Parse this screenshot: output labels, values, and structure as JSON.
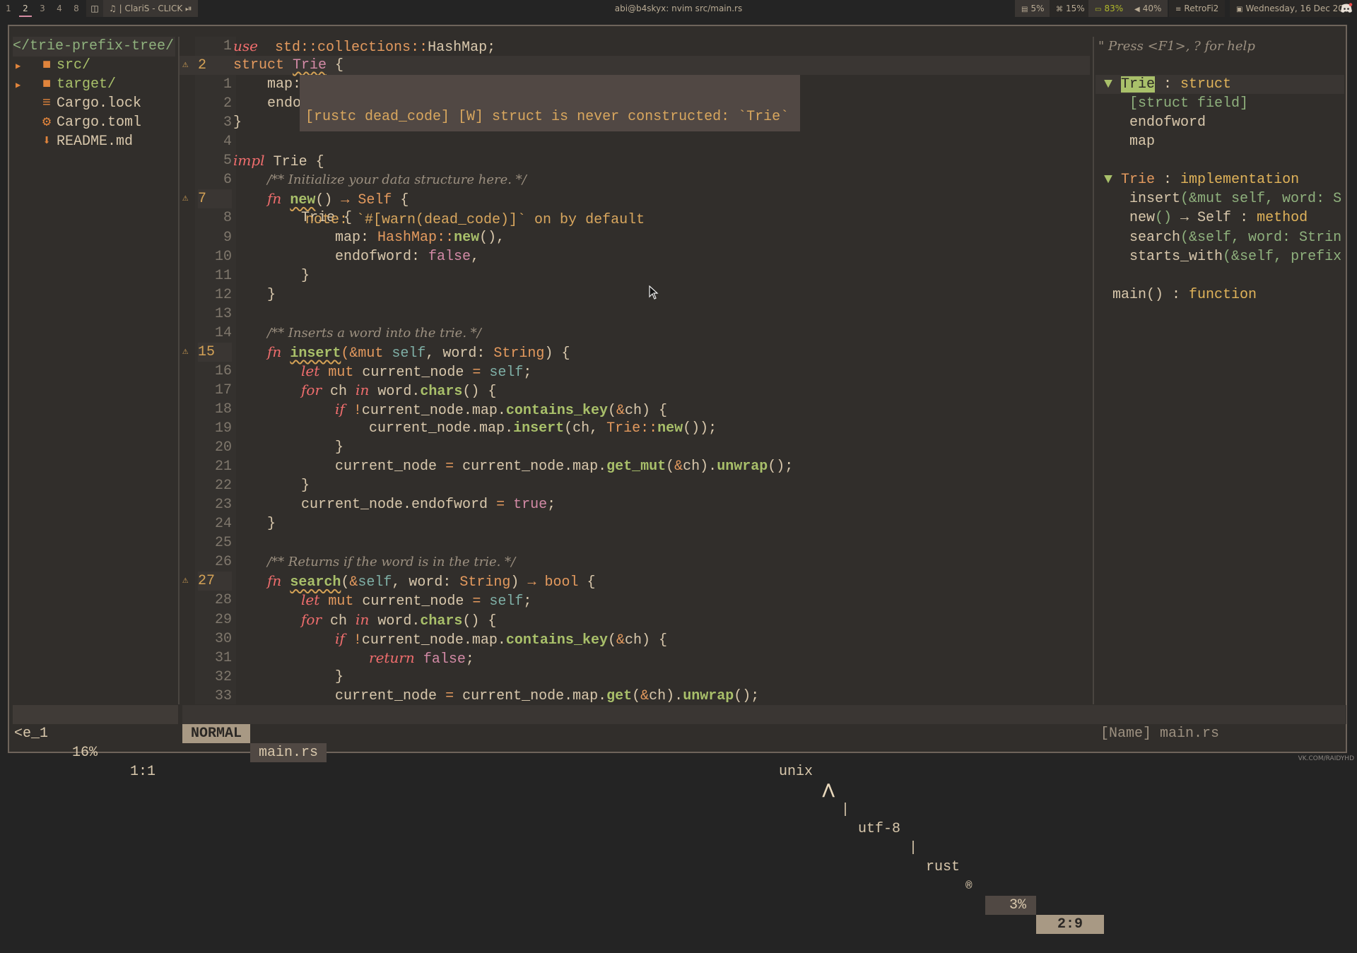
{
  "topbar": {
    "workspaces": [
      "1",
      "2",
      "3",
      "4",
      "8"
    ],
    "active_workspace": "2",
    "layout_icon": "layout-icon",
    "music": {
      "icon": "music-note-icon",
      "text": "| ClariS - CLICK",
      "control_icon": "play-pause-icon"
    },
    "window_title": "abi@b4skyx: nvim src/main.rs",
    "modules": [
      {
        "name": "memory",
        "icon": "memory-icon",
        "glyph": "▤",
        "value": "5%",
        "color": "#b9ab94"
      },
      {
        "name": "cpu",
        "icon": "cpu-icon",
        "glyph": "⌘",
        "value": "15%",
        "color": "#b9ab94"
      },
      {
        "name": "battery",
        "icon": "battery-icon",
        "glyph": "▭",
        "value": "83%",
        "color": "#b0b82a"
      },
      {
        "name": "volume",
        "icon": "volume-icon",
        "glyph": "◀",
        "value": "40%",
        "color": "#b9ab94"
      },
      {
        "name": "network",
        "icon": "wifi-icon",
        "glyph": "≡",
        "value": "RetroFi2",
        "color": "#b9ab94"
      },
      {
        "name": "date",
        "icon": "calendar-icon",
        "glyph": "▣",
        "value": "Wednesday, 16 Dec 20",
        "color": "#b9ab94"
      }
    ],
    "tray_icon": "discord-icon"
  },
  "filetree": {
    "root": "</trie-prefix-tree/",
    "items": [
      {
        "arrow": "▶",
        "icon": "folder-icon",
        "glyph": "■",
        "label": "src/",
        "type": "dir"
      },
      {
        "arrow": "▶",
        "icon": "folder-icon",
        "glyph": "■",
        "label": "target/",
        "type": "dir"
      },
      {
        "arrow": "",
        "icon": "lines-icon",
        "glyph": "≡",
        "label": "Cargo.lock",
        "type": "file"
      },
      {
        "arrow": "",
        "icon": "gear-icon",
        "glyph": "⚙",
        "label": "Cargo.toml",
        "type": "file"
      },
      {
        "arrow": "",
        "icon": "download-arrow-icon",
        "glyph": "⬇",
        "label": "README.md",
        "type": "file"
      }
    ]
  },
  "editor": {
    "diagnostic_popup": {
      "line1": "[rustc dead_code] [W] struct is never constructed: `Trie`",
      "line2": "",
      "line3": "note: `#[warn(dead_code)]` on by default"
    },
    "lines": [
      {
        "n": "1",
        "sign": "",
        "tokens": [
          [
            "kw",
            "use"
          ],
          [
            "",
            "  "
          ],
          [
            "ty",
            "std"
          ],
          [
            "op",
            "::"
          ],
          [
            "ty",
            "collections"
          ],
          [
            "op",
            "::"
          ],
          [
            "",
            "HashMap;"
          ]
        ]
      },
      {
        "n": "2",
        "sign": "⚠",
        "cur": true,
        "tokens": [
          [
            "ty",
            "struct "
          ],
          [
            "pk squig",
            "Trie"
          ],
          [
            "",
            " {"
          ]
        ]
      },
      {
        "n": "1",
        "sign": "",
        "tokens": [
          [
            "",
            "    map: HashMap<char, Trie>,"
          ]
        ]
      },
      {
        "n": "2",
        "sign": "",
        "tokens": [
          [
            "",
            "    endofword: bool,"
          ]
        ]
      },
      {
        "n": "3",
        "sign": "",
        "tokens": [
          [
            "",
            "}"
          ]
        ]
      },
      {
        "n": "4",
        "sign": "",
        "tokens": []
      },
      {
        "n": "5",
        "sign": "",
        "tokens": [
          [
            "kw",
            "impl"
          ],
          [
            "",
            " Trie {"
          ]
        ]
      },
      {
        "n": "6",
        "sign": "",
        "tokens": [
          [
            "",
            "    "
          ],
          [
            "cm",
            "/** Initialize your data structure here. */"
          ]
        ]
      },
      {
        "n": "7",
        "sign": "⚠",
        "tokens": [
          [
            "",
            "    "
          ],
          [
            "kw",
            "fn"
          ],
          [
            "",
            " "
          ],
          [
            "fnn squig",
            "new"
          ],
          [
            "",
            "() "
          ],
          [
            "op",
            "→"
          ],
          [
            "",
            " "
          ],
          [
            "ty",
            "Self"
          ],
          [
            "",
            " {"
          ]
        ]
      },
      {
        "n": "8",
        "sign": "",
        "tokens": [
          [
            "",
            "        Trie {"
          ]
        ]
      },
      {
        "n": "9",
        "sign": "",
        "tokens": [
          [
            "",
            "            map: "
          ],
          [
            "ty",
            "HashMap"
          ],
          [
            "op",
            "::"
          ],
          [
            "fnn",
            "new"
          ],
          [
            "",
            "(),"
          ]
        ]
      },
      {
        "n": "10",
        "sign": "",
        "tokens": [
          [
            "",
            "            endofword: "
          ],
          [
            "bool",
            "false"
          ],
          [
            "",
            ","
          ]
        ]
      },
      {
        "n": "11",
        "sign": "",
        "tokens": [
          [
            "",
            "        }"
          ]
        ]
      },
      {
        "n": "12",
        "sign": "",
        "tokens": [
          [
            "",
            "    }"
          ]
        ]
      },
      {
        "n": "13",
        "sign": "",
        "tokens": []
      },
      {
        "n": "14",
        "sign": "",
        "tokens": [
          [
            "",
            "    "
          ],
          [
            "cm",
            "/** Inserts a word into the trie. */"
          ]
        ]
      },
      {
        "n": "15",
        "sign": "⚠",
        "tokens": [
          [
            "",
            "    "
          ],
          [
            "kw",
            "fn"
          ],
          [
            "",
            " "
          ],
          [
            "fnn squig",
            "insert"
          ],
          [
            "op",
            "(&"
          ],
          [
            "ty",
            "mut"
          ],
          [
            "",
            " "
          ],
          [
            "sf",
            "self"
          ],
          [
            "",
            ", word: "
          ],
          [
            "ty",
            "String"
          ],
          [
            "",
            ") {"
          ]
        ]
      },
      {
        "n": "16",
        "sign": "",
        "tokens": [
          [
            "",
            "        "
          ],
          [
            "kw",
            "let"
          ],
          [
            "",
            " "
          ],
          [
            "ty",
            "mut"
          ],
          [
            "",
            " current_node "
          ],
          [
            "op",
            "="
          ],
          [
            "",
            " "
          ],
          [
            "sf",
            "self"
          ],
          [
            "",
            ";"
          ]
        ]
      },
      {
        "n": "17",
        "sign": "",
        "tokens": [
          [
            "",
            "        "
          ],
          [
            "kw",
            "for"
          ],
          [
            "",
            " ch "
          ],
          [
            "kw",
            "in"
          ],
          [
            "",
            " word."
          ],
          [
            "fnn",
            "chars"
          ],
          [
            "",
            "() {"
          ]
        ]
      },
      {
        "n": "18",
        "sign": "",
        "tokens": [
          [
            "",
            "            "
          ],
          [
            "kw",
            "if"
          ],
          [
            "",
            " "
          ],
          [
            "op",
            "!"
          ],
          [
            "",
            "current_node.map."
          ],
          [
            "fnn",
            "contains_key"
          ],
          [
            "",
            "("
          ],
          [
            "op",
            "&"
          ],
          [
            "",
            "ch) {"
          ]
        ]
      },
      {
        "n": "19",
        "sign": "",
        "tokens": [
          [
            "",
            "                current_node.map."
          ],
          [
            "fnn",
            "insert"
          ],
          [
            "",
            "(ch, "
          ],
          [
            "ty",
            "Trie"
          ],
          [
            "op",
            "::"
          ],
          [
            "fnn",
            "new"
          ],
          [
            "",
            "());"
          ]
        ]
      },
      {
        "n": "20",
        "sign": "",
        "tokens": [
          [
            "",
            "            }"
          ]
        ]
      },
      {
        "n": "21",
        "sign": "",
        "tokens": [
          [
            "",
            "            current_node "
          ],
          [
            "op",
            "="
          ],
          [
            "",
            " current_node.map."
          ],
          [
            "fnn",
            "get_mut"
          ],
          [
            "",
            "("
          ],
          [
            "op",
            "&"
          ],
          [
            "",
            "ch)."
          ],
          [
            "fnn",
            "unwrap"
          ],
          [
            "",
            "();"
          ]
        ]
      },
      {
        "n": "22",
        "sign": "",
        "tokens": [
          [
            "",
            "        }"
          ]
        ]
      },
      {
        "n": "23",
        "sign": "",
        "tokens": [
          [
            "",
            "        current_node.endofword "
          ],
          [
            "op",
            "="
          ],
          [
            "",
            " "
          ],
          [
            "bool",
            "true"
          ],
          [
            "",
            ";"
          ]
        ]
      },
      {
        "n": "24",
        "sign": "",
        "tokens": [
          [
            "",
            "    }"
          ]
        ]
      },
      {
        "n": "25",
        "sign": "",
        "tokens": []
      },
      {
        "n": "26",
        "sign": "",
        "tokens": [
          [
            "",
            "    "
          ],
          [
            "cm",
            "/** Returns if the word is in the trie. */"
          ]
        ]
      },
      {
        "n": "27",
        "sign": "⚠",
        "tokens": [
          [
            "",
            "    "
          ],
          [
            "kw",
            "fn"
          ],
          [
            "",
            " "
          ],
          [
            "fnn squig",
            "search"
          ],
          [
            "",
            "("
          ],
          [
            "op",
            "&"
          ],
          [
            "sf",
            "self"
          ],
          [
            "",
            ", word: "
          ],
          [
            "ty",
            "String"
          ],
          [
            "",
            ") "
          ],
          [
            "op",
            "→"
          ],
          [
            "",
            " "
          ],
          [
            "ty",
            "bool"
          ],
          [
            "",
            " {"
          ]
        ]
      },
      {
        "n": "28",
        "sign": "",
        "tokens": [
          [
            "",
            "        "
          ],
          [
            "kw",
            "let"
          ],
          [
            "",
            " "
          ],
          [
            "ty",
            "mut"
          ],
          [
            "",
            " current_node "
          ],
          [
            "op",
            "="
          ],
          [
            "",
            " "
          ],
          [
            "sf",
            "self"
          ],
          [
            "",
            ";"
          ]
        ]
      },
      {
        "n": "29",
        "sign": "",
        "tokens": [
          [
            "",
            "        "
          ],
          [
            "kw",
            "for"
          ],
          [
            "",
            " ch "
          ],
          [
            "kw",
            "in"
          ],
          [
            "",
            " word."
          ],
          [
            "fnn",
            "chars"
          ],
          [
            "",
            "() {"
          ]
        ]
      },
      {
        "n": "30",
        "sign": "",
        "tokens": [
          [
            "",
            "            "
          ],
          [
            "kw",
            "if"
          ],
          [
            "",
            " "
          ],
          [
            "op",
            "!"
          ],
          [
            "",
            "current_node.map."
          ],
          [
            "fnn",
            "contains_key"
          ],
          [
            "",
            "("
          ],
          [
            "op",
            "&"
          ],
          [
            "",
            "ch) {"
          ]
        ]
      },
      {
        "n": "31",
        "sign": "",
        "tokens": [
          [
            "",
            "                "
          ],
          [
            "kw",
            "return"
          ],
          [
            "",
            " "
          ],
          [
            "bool",
            "false"
          ],
          [
            "",
            ";"
          ]
        ]
      },
      {
        "n": "32",
        "sign": "",
        "tokens": [
          [
            "",
            "            }"
          ]
        ]
      },
      {
        "n": "33",
        "sign": "",
        "tokens": [
          [
            "",
            "            current_node "
          ],
          [
            "op",
            "="
          ],
          [
            "",
            " current_node.map."
          ],
          [
            "fnn",
            "get"
          ],
          [
            "",
            "("
          ],
          [
            "op",
            "&"
          ],
          [
            "",
            "ch)."
          ],
          [
            "fnn",
            "unwrap"
          ],
          [
            "",
            "();"
          ]
        ]
      }
    ]
  },
  "tagbar": {
    "help": "\" Press <F1>, ? for help",
    "groups": [
      {
        "arrow": "▼",
        "name": "Trie",
        "kind": "struct",
        "highlight": true,
        "children": [
          {
            "text": "[struct field]",
            "cls": "grn"
          },
          {
            "text": "endofword",
            "cls": ""
          },
          {
            "text": "map",
            "cls": ""
          }
        ]
      },
      {
        "arrow": "▼",
        "name": "Trie",
        "kind": "implementation",
        "highlight": false,
        "children": [
          {
            "text": "insert",
            "rest": "(&mut self, word: S"
          },
          {
            "text": "new",
            "rest": "() → Self",
            "suffix": " : method"
          },
          {
            "text": "search",
            "rest": "(&self, word: Strin"
          },
          {
            "text": "starts_with",
            "rest": "(&self, prefix"
          }
        ]
      }
    ],
    "function": {
      "name": "main()",
      "kind": "function"
    }
  },
  "statusline": {
    "left_name": "<e_1",
    "left_percent": "16%",
    "left_pos": "1:1",
    "mode": "NORMAL",
    "filename": "main.rs",
    "fileformat": "unix",
    "os_icon": "arch-linux-icon",
    "encoding": "utf-8",
    "filetype": "rust",
    "filetype_icon": "rust-icon",
    "percent": "3%",
    "position": "2:9",
    "right_name": "[Name] main.rs"
  },
  "watermark": "VK.COM/RAIDYHD",
  "colors": {
    "bg": "#312e2b",
    "accent_pink": "#d68ca2",
    "mode_bg": "#a89984",
    "warning": "#d4a256",
    "keyword": "#ef6d6d",
    "function": "#a9c06a"
  }
}
